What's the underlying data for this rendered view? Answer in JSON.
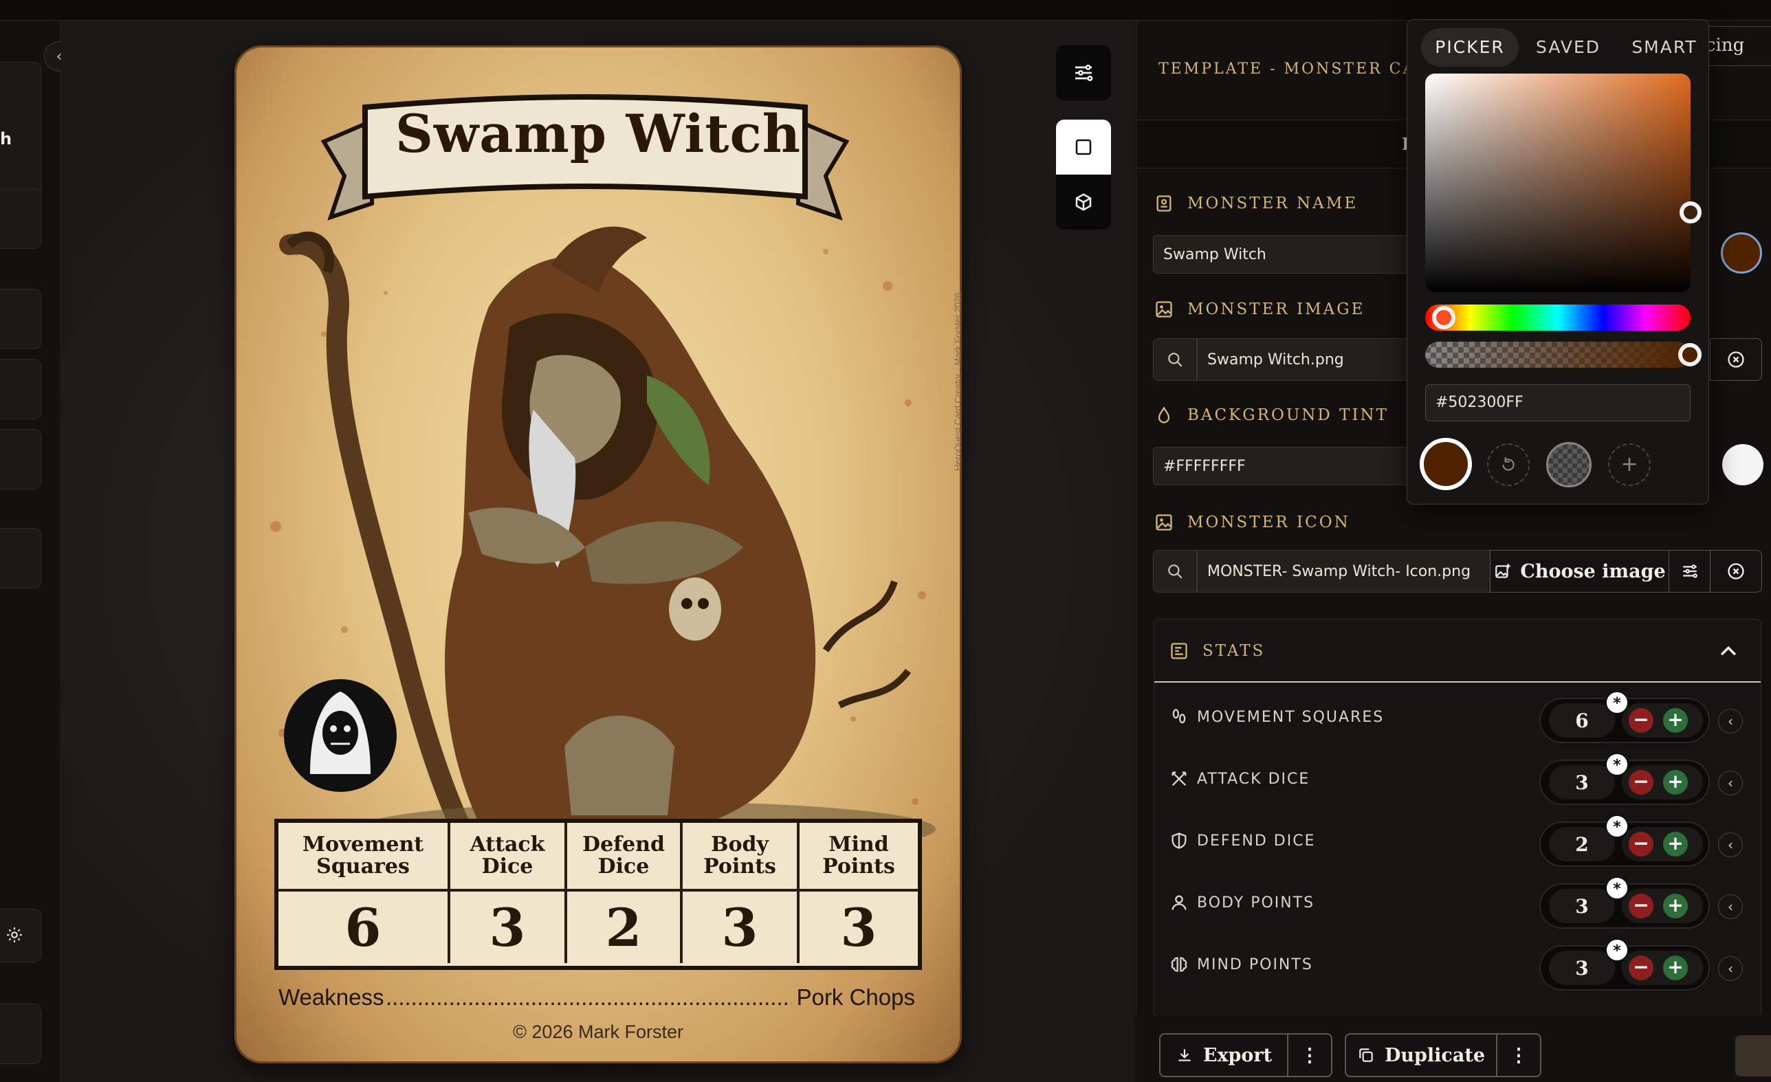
{
  "left_rail": {
    "partial_text": "h",
    "collapse_icon": "‹"
  },
  "card": {
    "title": "Swamp Witch",
    "vertical_credit": "HeroQuest Card Creator · Mark Forster 2026",
    "stats_headers": [
      "Movement\nSquares",
      "Attack\nDice",
      "Defend\nDice",
      "Body\nPoints",
      "Mind\nPoints"
    ],
    "stats_values": [
      "6",
      "3",
      "2",
      "3",
      "3"
    ],
    "weakness_label": "Weakness",
    "weakness_dots": "..........................................................................................................................................",
    "weakness_value": "Pork Chops",
    "copyright": "© 2026 Mark Forster"
  },
  "panel": {
    "template_title": "TEMPLATE - MONSTER CARD",
    "partial_button": "cing",
    "sub_head_letter": "F",
    "monster_name_label": "MONSTER NAME",
    "monster_name_value": "Swamp Witch",
    "monster_image_label": "MONSTER IMAGE",
    "monster_image_value": "Swamp Witch.png",
    "background_tint_label": "BACKGROUND TINT",
    "background_tint_value": "#FFFFFFFF",
    "monster_icon_label": "MONSTER ICON",
    "monster_icon_value": "MONSTER- Swamp Witch- Icon.png",
    "choose_image_label": "Choose image",
    "stats_label": "STATS",
    "stats": [
      {
        "label": "MOVEMENT SQUARES",
        "value": "6",
        "icon": "footprints-icon"
      },
      {
        "label": "ATTACK DICE",
        "value": "3",
        "icon": "crossed-swords-icon"
      },
      {
        "label": "DEFEND DICE",
        "value": "2",
        "icon": "shield-icon"
      },
      {
        "label": "BODY POINTS",
        "value": "3",
        "icon": "person-icon"
      },
      {
        "label": "MIND POINTS",
        "value": "3",
        "icon": "brain-icon"
      }
    ],
    "stepper_star": "*",
    "stepper_minus": "−",
    "stepper_plus": "+",
    "chevron": "‹",
    "export_label": "Export",
    "duplicate_label": "Duplicate",
    "more_icon": "⋮"
  },
  "color_picker": {
    "tabs": [
      "PICKER",
      "SAVED",
      "SMART"
    ],
    "active_tab": "PICKER",
    "hex_value": "#502300FF",
    "current_color": "#502300",
    "plus": "+"
  },
  "colors": {
    "accent_gold": "#d6b572",
    "minus_red": "#8f1f1f",
    "plus_green": "#2d6e3a",
    "swatch_brown": "#502300"
  }
}
